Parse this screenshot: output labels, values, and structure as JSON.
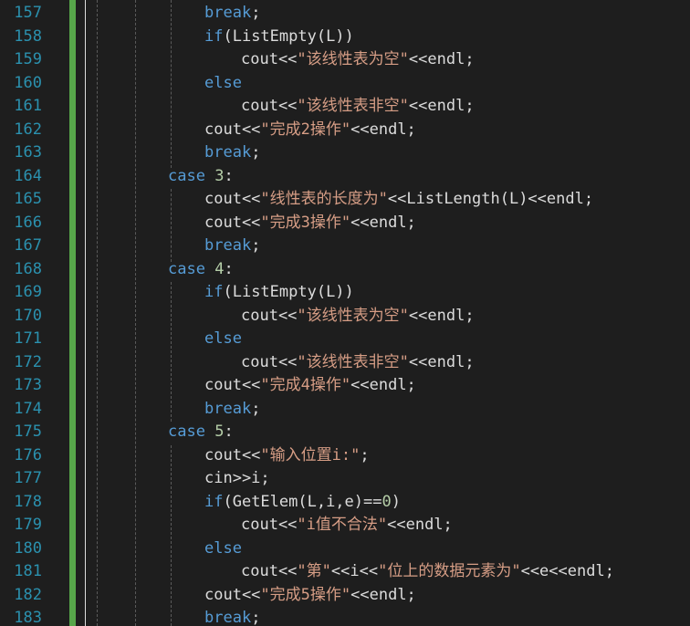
{
  "editor": {
    "colors": {
      "background": "#1e1e1e",
      "line_number": "#2b91af",
      "keyword": "#569cd6",
      "string": "#d69d85",
      "number": "#b5cea8",
      "text": "#dcdcdc",
      "change_bar": "#57a64a"
    },
    "lines": [
      {
        "n": "157",
        "indent": 2,
        "tokens": [
          {
            "c": "kw",
            "t": "break"
          },
          {
            "c": "id",
            "t": ";"
          }
        ]
      },
      {
        "n": "158",
        "indent": 2,
        "tokens": [
          {
            "c": "kw",
            "t": "if"
          },
          {
            "c": "id",
            "t": "(ListEmpty(L))"
          }
        ]
      },
      {
        "n": "159",
        "indent": 3,
        "tokens": [
          {
            "c": "id",
            "t": "cout<<"
          },
          {
            "c": "str",
            "t": "\"该线性表为空\""
          },
          {
            "c": "id",
            "t": "<<endl;"
          }
        ]
      },
      {
        "n": "160",
        "indent": 2,
        "tokens": [
          {
            "c": "kw",
            "t": "else"
          }
        ]
      },
      {
        "n": "161",
        "indent": 3,
        "tokens": [
          {
            "c": "id",
            "t": "cout<<"
          },
          {
            "c": "str",
            "t": "\"该线性表非空\""
          },
          {
            "c": "id",
            "t": "<<endl;"
          }
        ]
      },
      {
        "n": "162",
        "indent": 2,
        "tokens": [
          {
            "c": "id",
            "t": "cout<<"
          },
          {
            "c": "str",
            "t": "\"完成2操作\""
          },
          {
            "c": "id",
            "t": "<<endl;"
          }
        ]
      },
      {
        "n": "163",
        "indent": 2,
        "tokens": [
          {
            "c": "kw",
            "t": "break"
          },
          {
            "c": "id",
            "t": ";"
          }
        ]
      },
      {
        "n": "164",
        "indent": 1,
        "tokens": [
          {
            "c": "kw",
            "t": "case"
          },
          {
            "c": "id",
            "t": " "
          },
          {
            "c": "num",
            "t": "3"
          },
          {
            "c": "id",
            "t": ":"
          }
        ]
      },
      {
        "n": "165",
        "indent": 2,
        "tokens": [
          {
            "c": "id",
            "t": "cout<<"
          },
          {
            "c": "str",
            "t": "\"线性表的长度为\""
          },
          {
            "c": "id",
            "t": "<<ListLength(L)<<endl;"
          }
        ]
      },
      {
        "n": "166",
        "indent": 2,
        "tokens": [
          {
            "c": "id",
            "t": "cout<<"
          },
          {
            "c": "str",
            "t": "\"完成3操作\""
          },
          {
            "c": "id",
            "t": "<<endl;"
          }
        ]
      },
      {
        "n": "167",
        "indent": 2,
        "tokens": [
          {
            "c": "kw",
            "t": "break"
          },
          {
            "c": "id",
            "t": ";"
          }
        ]
      },
      {
        "n": "168",
        "indent": 1,
        "tokens": [
          {
            "c": "kw",
            "t": "case"
          },
          {
            "c": "id",
            "t": " "
          },
          {
            "c": "num",
            "t": "4"
          },
          {
            "c": "id",
            "t": ":"
          }
        ]
      },
      {
        "n": "169",
        "indent": 2,
        "tokens": [
          {
            "c": "kw",
            "t": "if"
          },
          {
            "c": "id",
            "t": "(ListEmpty(L))"
          }
        ]
      },
      {
        "n": "170",
        "indent": 3,
        "tokens": [
          {
            "c": "id",
            "t": "cout<<"
          },
          {
            "c": "str",
            "t": "\"该线性表为空\""
          },
          {
            "c": "id",
            "t": "<<endl;"
          }
        ]
      },
      {
        "n": "171",
        "indent": 2,
        "tokens": [
          {
            "c": "kw",
            "t": "else"
          }
        ]
      },
      {
        "n": "172",
        "indent": 3,
        "tokens": [
          {
            "c": "id",
            "t": "cout<<"
          },
          {
            "c": "str",
            "t": "\"该线性表非空\""
          },
          {
            "c": "id",
            "t": "<<endl;"
          }
        ]
      },
      {
        "n": "173",
        "indent": 2,
        "tokens": [
          {
            "c": "id",
            "t": "cout<<"
          },
          {
            "c": "str",
            "t": "\"完成4操作\""
          },
          {
            "c": "id",
            "t": "<<endl;"
          }
        ]
      },
      {
        "n": "174",
        "indent": 2,
        "tokens": [
          {
            "c": "kw",
            "t": "break"
          },
          {
            "c": "id",
            "t": ";"
          }
        ]
      },
      {
        "n": "175",
        "indent": 1,
        "tokens": [
          {
            "c": "kw",
            "t": "case"
          },
          {
            "c": "id",
            "t": " "
          },
          {
            "c": "num",
            "t": "5"
          },
          {
            "c": "id",
            "t": ":"
          }
        ]
      },
      {
        "n": "176",
        "indent": 2,
        "tokens": [
          {
            "c": "id",
            "t": "cout<<"
          },
          {
            "c": "str",
            "t": "\"输入位置i:\""
          },
          {
            "c": "id",
            "t": ";"
          }
        ]
      },
      {
        "n": "177",
        "indent": 2,
        "tokens": [
          {
            "c": "id",
            "t": "cin>>i;"
          }
        ]
      },
      {
        "n": "178",
        "indent": 2,
        "tokens": [
          {
            "c": "kw",
            "t": "if"
          },
          {
            "c": "id",
            "t": "(GetElem(L,i,e)=="
          },
          {
            "c": "num",
            "t": "0"
          },
          {
            "c": "id",
            "t": ")"
          }
        ]
      },
      {
        "n": "179",
        "indent": 3,
        "tokens": [
          {
            "c": "id",
            "t": "cout<<"
          },
          {
            "c": "str",
            "t": "\"i值不合法\""
          },
          {
            "c": "id",
            "t": "<<endl;"
          }
        ]
      },
      {
        "n": "180",
        "indent": 2,
        "tokens": [
          {
            "c": "kw",
            "t": "else"
          }
        ]
      },
      {
        "n": "181",
        "indent": 3,
        "tokens": [
          {
            "c": "id",
            "t": "cout<<"
          },
          {
            "c": "str",
            "t": "\"第\""
          },
          {
            "c": "id",
            "t": "<<i<<"
          },
          {
            "c": "str",
            "t": "\"位上的数据元素为\""
          },
          {
            "c": "id",
            "t": "<<e<<endl;"
          }
        ]
      },
      {
        "n": "182",
        "indent": 2,
        "tokens": [
          {
            "c": "id",
            "t": "cout<<"
          },
          {
            "c": "str",
            "t": "\"完成5操作\""
          },
          {
            "c": "id",
            "t": "<<endl;"
          }
        ]
      },
      {
        "n": "183",
        "indent": 2,
        "tokens": [
          {
            "c": "kw",
            "t": "break"
          },
          {
            "c": "id",
            "t": ";"
          }
        ]
      }
    ]
  }
}
